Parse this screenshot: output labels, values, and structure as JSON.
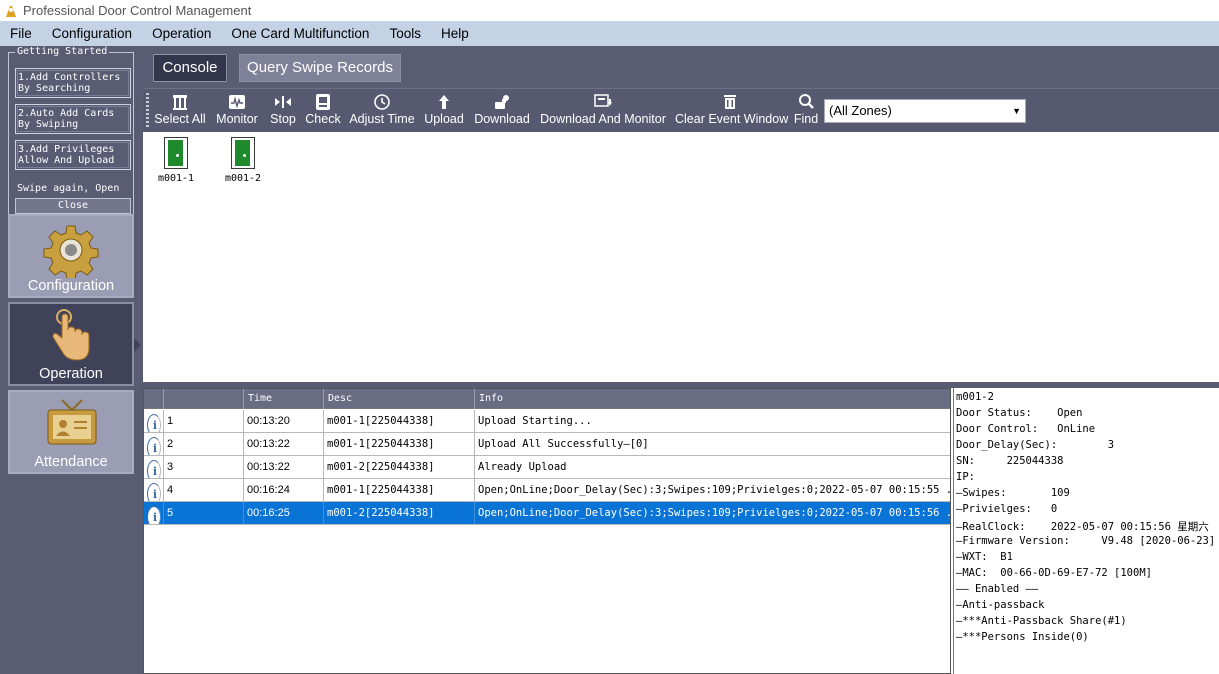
{
  "window": {
    "title": "Professional Door Control Management"
  },
  "menu": [
    "File",
    "Configuration",
    "Operation",
    "One Card Multifunction",
    "Tools",
    "Help"
  ],
  "getting_started": {
    "legend": "Getting Started",
    "steps": [
      [
        "1.Add Controllers",
        "By Searching"
      ],
      [
        "2.Auto Add Cards",
        "By Swiping"
      ],
      [
        "3.Add Privileges",
        "Allow And Upload"
      ]
    ],
    "hint": "Swipe again, Open",
    "close_label": "Close"
  },
  "nav": [
    {
      "label": "Configuration",
      "icon": "gear-icon",
      "active": false
    },
    {
      "label": "Operation",
      "icon": "hand-pointer-icon",
      "active": true
    },
    {
      "label": "Attendance",
      "icon": "id-card-icon",
      "active": false
    }
  ],
  "tabs": [
    {
      "label": "Console",
      "active": true
    },
    {
      "label": "Query Swipe Records",
      "active": false
    }
  ],
  "toolbar": {
    "buttons": [
      {
        "label": "Select All",
        "icon": "select-all-icon"
      },
      {
        "label": "Monitor",
        "icon": "monitor-icon"
      },
      {
        "label": "Stop",
        "icon": "stop-icon"
      },
      {
        "label": "Check",
        "icon": "check-icon"
      },
      {
        "label": "Adjust Time",
        "icon": "clock-icon"
      },
      {
        "label": "Upload",
        "icon": "upload-icon"
      },
      {
        "label": "Download",
        "icon": "download-icon"
      },
      {
        "label": "Download And Monitor",
        "icon": "download-monitor-icon"
      },
      {
        "label": "Clear Event Window",
        "icon": "trash-icon"
      },
      {
        "label": "Find",
        "icon": "search-icon"
      }
    ],
    "zone_select": "(All Zones)"
  },
  "doors": [
    {
      "label": "m001-1",
      "icon": "door-open-icon",
      "status_color": "#1f8a2c"
    },
    {
      "label": "m001-2",
      "icon": "door-open-icon",
      "status_color": "#1f8a2c"
    }
  ],
  "events": {
    "columns": [
      "",
      "",
      "Time",
      "Desc",
      "Info"
    ],
    "rows": [
      {
        "no": "1",
        "time": "00:13:20",
        "desc": "m001-1[225044338]",
        "info": "Upload Starting...",
        "selected": false
      },
      {
        "no": "2",
        "time": "00:13:22",
        "desc": "m001-1[225044338]",
        "info": "Upload All Successfully—[0]",
        "selected": false
      },
      {
        "no": "3",
        "time": "00:13:22",
        "desc": "m001-2[225044338]",
        "info": "Already Upload",
        "selected": false
      },
      {
        "no": "4",
        "time": "00:16:24",
        "desc": "m001-1[225044338]",
        "info": "Open;OnLine;Door_Delay(Sec):3;Swipes:109;Privielges:0;2022-05-07 00:15:55 ...",
        "selected": false
      },
      {
        "no": "5",
        "time": "00:16:25",
        "desc": "m001-2[225044338]",
        "info": "Open;OnLine;Door_Delay(Sec):3;Swipes:109;Privielges:0;2022-05-07 00:15:56 ...",
        "selected": true
      }
    ]
  },
  "detail": {
    "lines": [
      "m001-2",
      "Door Status:    Open",
      "Door Control:   OnLine",
      "Door_Delay(Sec):        3",
      "SN:     225044338",
      "IP:",
      "—Swipes:       109",
      "—Privielges:   0",
      "—RealClock:    2022-05-07 00:15:56 星期六",
      "—Firmware Version:     V9.48 [2020-06-23]",
      "—WXT:  B1",
      "—MAC:  00-66-0D-69-E7-72 [100M]",
      "—— Enabled ——",
      "—Anti-passback",
      "—***Anti-Passback Share(#1)",
      "—***Persons Inside(0)"
    ]
  }
}
